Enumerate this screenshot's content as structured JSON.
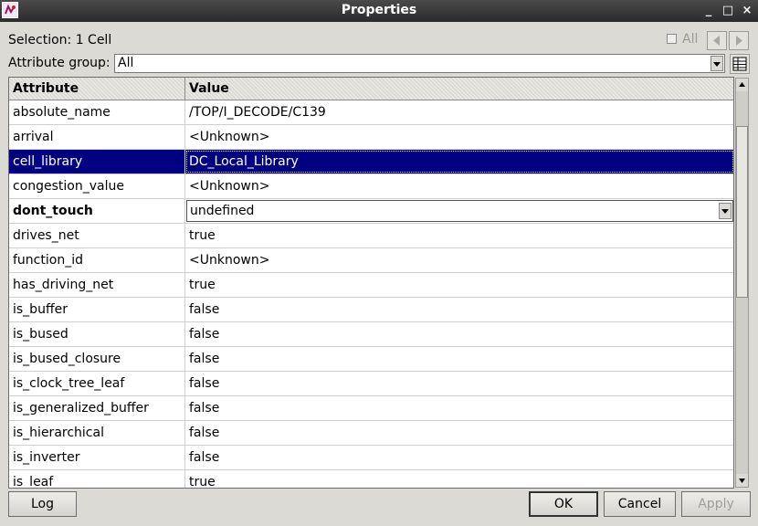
{
  "window": {
    "title": "Properties",
    "controls": {
      "minimize": "_",
      "maximize": "□",
      "close": "×"
    }
  },
  "selection": {
    "label": "Selection:",
    "value": "1 Cell"
  },
  "show_all": {
    "label": "All",
    "checked": false
  },
  "attribute_group": {
    "label": "Attribute group:",
    "value": "All"
  },
  "table": {
    "headers": {
      "attribute": "Attribute",
      "value": "Value"
    },
    "rows": [
      {
        "attribute": "absolute_name",
        "value": "/TOP/I_DECODE/C139"
      },
      {
        "attribute": "arrival",
        "value": "<Unknown>"
      },
      {
        "attribute": "cell_library",
        "value": "DC_Local_Library",
        "selected": true
      },
      {
        "attribute": "congestion_value",
        "value": "<Unknown>"
      },
      {
        "attribute": "dont_touch",
        "value": "undefined",
        "editable": true
      },
      {
        "attribute": "drives_net",
        "value": "true"
      },
      {
        "attribute": "function_id",
        "value": "<Unknown>"
      },
      {
        "attribute": "has_driving_net",
        "value": "true"
      },
      {
        "attribute": "is_buffer",
        "value": "false"
      },
      {
        "attribute": "is_bused",
        "value": "false"
      },
      {
        "attribute": "is_bused_closure",
        "value": "false"
      },
      {
        "attribute": "is_clock_tree_leaf",
        "value": "false"
      },
      {
        "attribute": "is_generalized_buffer",
        "value": "false"
      },
      {
        "attribute": "is_hierarchical",
        "value": "false"
      },
      {
        "attribute": "is_inverter",
        "value": "false"
      },
      {
        "attribute": "is_leaf",
        "value": "true"
      }
    ]
  },
  "buttons": {
    "log": "Log",
    "ok": "OK",
    "cancel": "Cancel",
    "apply": "Apply"
  },
  "colors": {
    "selection_bg": "#000080",
    "titlebar_bg": "#333333",
    "dialog_bg": "#dcdad5"
  },
  "icons": {
    "app": "app-logo-icon",
    "prev": "arrow-left-icon",
    "next": "arrow-right-icon",
    "dropdown": "chevron-down-icon",
    "table_view": "table-view-icon",
    "scroll_up": "scroll-up-icon",
    "scroll_down": "scroll-down-icon"
  }
}
